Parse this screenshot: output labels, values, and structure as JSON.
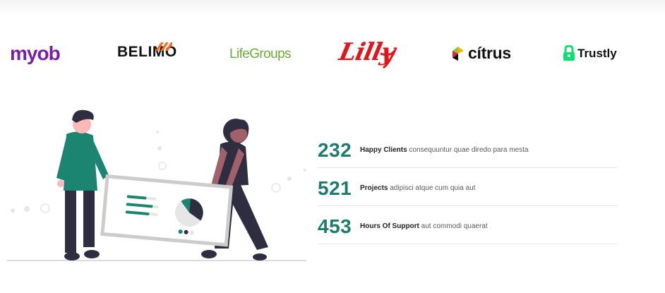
{
  "clients": {
    "myob": "myob",
    "belimo": "BELIMO",
    "lifegroups": "LifeGroups",
    "lilly": "Lilly",
    "citrus": "cítrus",
    "trustly": "Trustly"
  },
  "brand_colors": {
    "myob": "#7a1fa2",
    "belimo_accent": "#f26b21",
    "lifegroups": "#6fab3c",
    "lilly": "#e0161c",
    "trustly": "#0ee06e",
    "stat_number": "#1c7c6e"
  },
  "stats": [
    {
      "number": "232",
      "label": "Happy Clients",
      "text": "consequuntur quae diredo para mesta"
    },
    {
      "number": "521",
      "label": "Projects",
      "text": "adipisci atque cum quia aut"
    },
    {
      "number": "453",
      "label": "Hours Of Support",
      "text": "aut commodi quaerat"
    }
  ]
}
